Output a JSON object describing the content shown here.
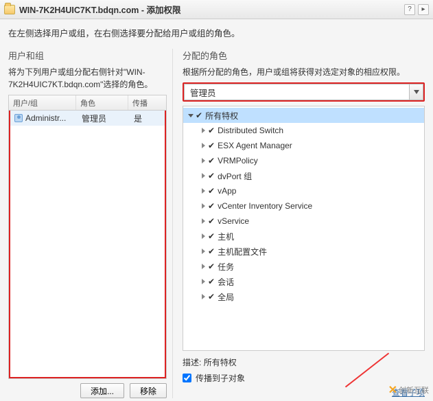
{
  "window": {
    "title_host": "WIN-7K2H4UIC7KT.bdqn.com",
    "title_action": "- 添加权限"
  },
  "instruction": "在左侧选择用户或组，在右侧选择要分配给用户或组的角色。",
  "left": {
    "heading": "用户和组",
    "subtext": "将为下列用户或组分配右侧针对\"WIN-7K2H4UIC7KT.bdqn.com\"选择的角色。",
    "columns": {
      "c1": "用户/组",
      "c2": "角色",
      "c3": "传播"
    },
    "row": {
      "user": "Administr...",
      "role": "管理员",
      "propagate": "是"
    },
    "add_btn": "添加...",
    "remove_btn": "移除"
  },
  "right": {
    "heading": "分配的角色",
    "subtext": "根据所分配的角色，用户或组将获得对选定对象的相应权限。",
    "selected_role": "管理员",
    "tree_root": "所有特权",
    "tree_items": [
      "Distributed Switch",
      "ESX Agent Manager",
      "VRMPolicy",
      "dvPort 组",
      "vApp",
      "vCenter Inventory Service",
      "vService",
      "主机",
      "主机配置文件",
      "任务",
      "会话",
      "全局"
    ],
    "desc_label": "描述:",
    "desc_value": "所有特权",
    "propagate_label": "传播到子对象",
    "propagate_checked": true,
    "view_children": "查看子项"
  },
  "watermark": "创新互联"
}
